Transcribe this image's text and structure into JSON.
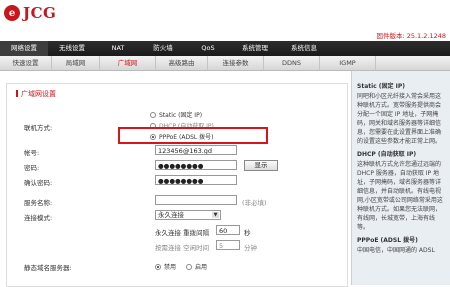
{
  "brand": {
    "name": "JCG",
    "logo_letter": "e"
  },
  "firmware": "固件版本: 25.1.2.1248",
  "nav": [
    "网络设置",
    "无线设置",
    "NAT",
    "防火墙",
    "QoS",
    "系统管理",
    "系统信息"
  ],
  "subnav": [
    "快速设置",
    "局域网",
    "广域网",
    "高级路由",
    "连接参数",
    "DDNS",
    "IGMP"
  ],
  "section_title": "广域网设置",
  "form": {
    "conn_label": "联机方式:",
    "options": [
      "Static (固定 IP)",
      "DHCP (自动获取 IP)",
      "PPPoE (ADSL 拨号)"
    ],
    "selected_option": 2,
    "account_label": "帐号:",
    "account_value": "123456@163.gd",
    "password_label": "密码:",
    "password_value": "●●●●●●●●",
    "show_button": "显示",
    "confirm_label": "确认密码:",
    "confirm_value": "●●●●●●●●",
    "service_label": "服务名称:",
    "service_hint": "(非必填)",
    "mode_label": "连接模式:",
    "mode_value": "永久连接",
    "redial_label": "永久连接 重拨间隔",
    "redial_value": "60",
    "redial_unit": "秒",
    "idle_label": "按需连接 空闲时间",
    "idle_value": "5",
    "idle_unit": "分钟",
    "dns_label": "静态域名服务器:",
    "dns_options": [
      "禁用",
      "启用"
    ],
    "dns_selected": 0
  },
  "sidebar": {
    "sections": [
      {
        "title": "Static (固定 IP)",
        "text": "同吧和小区光纤接入常会采用这种联机方式。宽带服务提供商会分配一个固定 IP 地址，子网掩码，网关和域名服务器等详细信息，您需要在此设置界面上准确的设置这些参数才能正常上网。"
      },
      {
        "title": "DHCP (自动获取 IP)",
        "text": "这种联机方式允许您通过远端的 DHCP 服务器，自动获取 IP 地址，子网掩码，域名服务器等详细信息，并自动联机。有线电视网,小区宽带或公司网络常采用这种联机方式。如果您无法联网，有线网，长城宽带，上海有线等。"
      },
      {
        "title": "PPPoE (ADSL 拨号)",
        "text": "中国电信，中国网通的 ADSL"
      }
    ]
  },
  "colors": {
    "accent": "#c8161d",
    "nav_bg": "#1f1f1f",
    "sidebar_bg": "#e9eef3"
  }
}
